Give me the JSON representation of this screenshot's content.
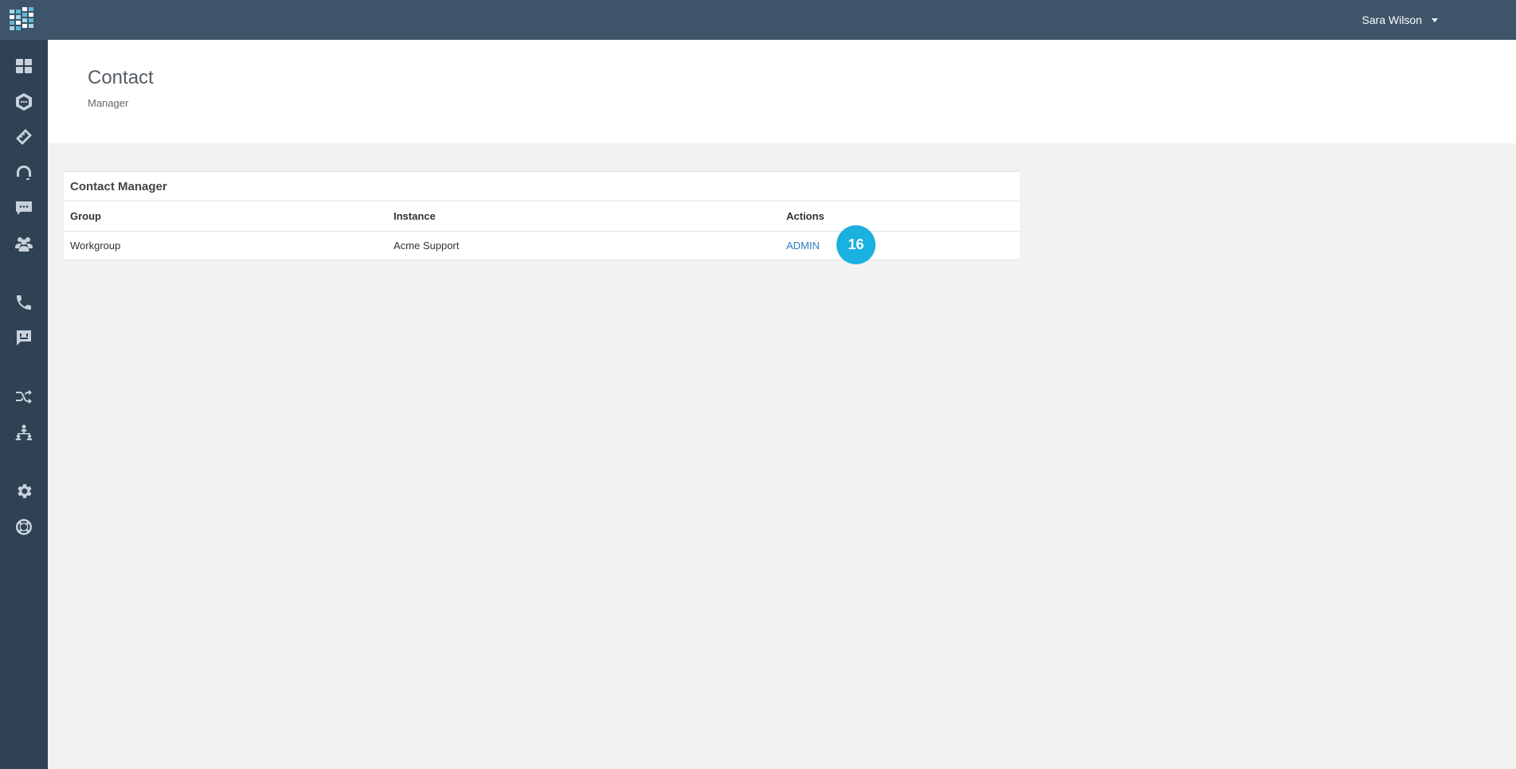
{
  "header": {
    "user_name": "Sara Wilson"
  },
  "sidebar": {
    "items": [
      {
        "icon": "dashboard-icon"
      },
      {
        "icon": "hexagon-chat-icon"
      },
      {
        "icon": "ticket-icon"
      },
      {
        "icon": "headset-icon"
      },
      {
        "icon": "chat-bubble-icon"
      },
      {
        "icon": "users-group-icon"
      },
      {
        "icon": "phone-icon"
      },
      {
        "icon": "message-icon"
      },
      {
        "icon": "shuffle-icon"
      },
      {
        "icon": "org-chart-icon"
      },
      {
        "icon": "gear-icon"
      },
      {
        "icon": "lifebuoy-icon"
      }
    ]
  },
  "page": {
    "title": "Contact",
    "subtitle": "Manager"
  },
  "panel": {
    "title": "Contact Manager",
    "columns": [
      "Group",
      "Instance",
      "Actions"
    ],
    "rows": [
      {
        "group": "Workgroup",
        "instance": "Acme Support",
        "action": "ADMIN"
      }
    ]
  },
  "step_badge": "16",
  "colors": {
    "topbar": "#3e5468",
    "sidebar": "#2e4253",
    "link": "#2a7dc2",
    "badge": "#1ab0e0"
  }
}
